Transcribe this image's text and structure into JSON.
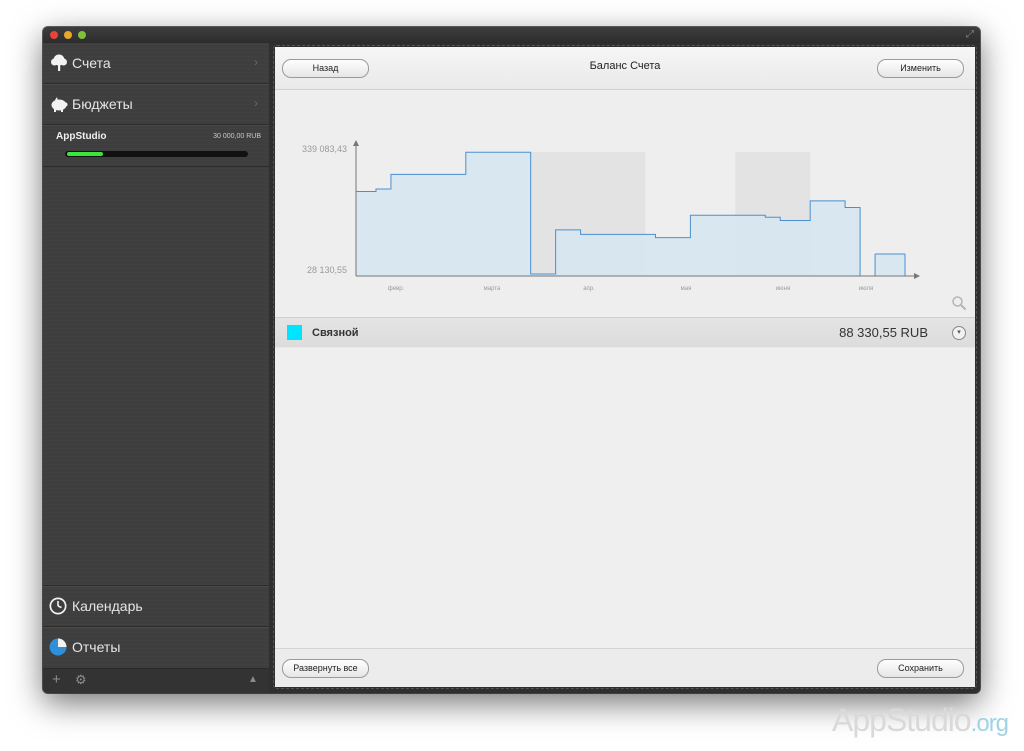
{
  "window": {
    "controls": [
      "close",
      "minimize",
      "zoom"
    ]
  },
  "sidebar": {
    "accounts_label": "Счета",
    "budgets_label": "Бюджеты",
    "budget": {
      "name": "AppStudio",
      "amount": "30 000,00 RUB",
      "progress": 0.2
    },
    "calendar_label": "Календарь",
    "reports_label": "Отчеты",
    "toolbar": {
      "add": "+",
      "settings": "⚙",
      "eject": "▲"
    }
  },
  "panel": {
    "back_label": "Назад",
    "title": "Баланс Счета",
    "edit_label": "Изменить",
    "expand_all_label": "Развернуть все",
    "save_label": "Сохранить"
  },
  "account": {
    "name": "Связной",
    "balance": "88 330,55 RUB",
    "color": "#00e5ff"
  },
  "chart_data": {
    "type": "area",
    "y_max_label": "339 083,43",
    "y_min_label": "28 130,55",
    "ylim": [
      28130.55,
      339083.43
    ],
    "x_labels": [
      "февр.",
      "марта",
      "апр.",
      "мая",
      "июня",
      "июля"
    ],
    "series": [
      {
        "points": [
          [
            0,
            235000
          ],
          [
            4,
            235000
          ],
          [
            4,
            241000
          ],
          [
            7,
            241000
          ],
          [
            7,
            277000
          ],
          [
            22,
            277000
          ],
          [
            22,
            331000
          ],
          [
            35,
            331000
          ],
          [
            35,
            33000
          ],
          [
            40,
            33000
          ],
          [
            40,
            141000
          ],
          [
            45,
            141000
          ],
          [
            45,
            130000
          ],
          [
            60,
            130000
          ],
          [
            60,
            122000
          ],
          [
            67,
            122000
          ],
          [
            67,
            177000
          ],
          [
            82,
            177000
          ],
          [
            82,
            172000
          ],
          [
            85,
            172000
          ],
          [
            85,
            164000
          ],
          [
            91,
            164000
          ],
          [
            91,
            212000
          ],
          [
            98,
            212000
          ],
          [
            98,
            196000
          ],
          [
            101,
            196000
          ],
          [
            101,
            28130.55
          ]
        ]
      },
      {
        "points": [
          [
            104,
            82000
          ],
          [
            110,
            82000
          ]
        ]
      }
    ],
    "shaded_bands": [
      [
        35,
        58
      ],
      [
        76,
        91
      ]
    ],
    "grid": false
  },
  "watermark": {
    "main": "AppStudio",
    "suffix": ".org"
  }
}
